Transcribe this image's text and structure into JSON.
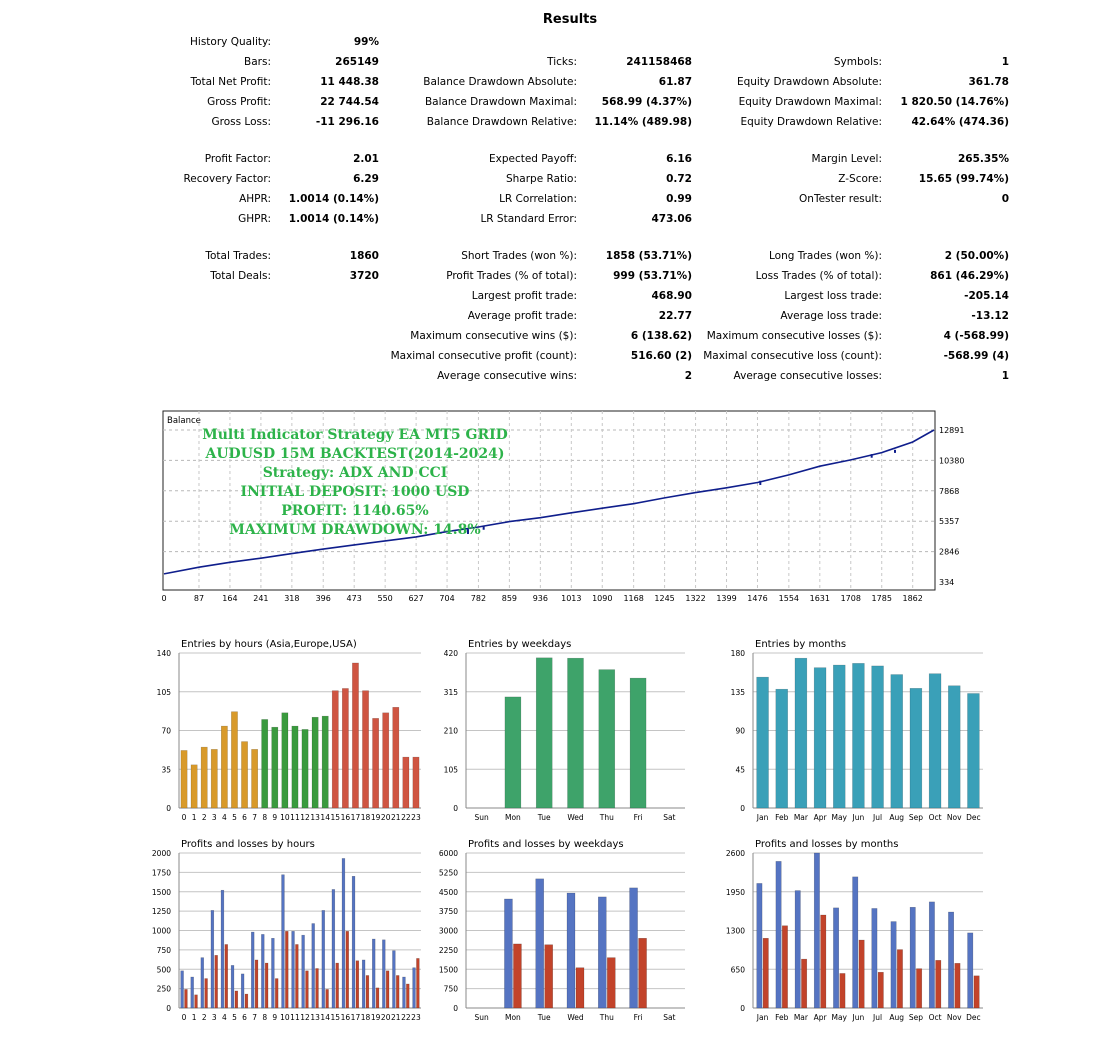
{
  "report": {
    "title": "Results",
    "col1": [
      {
        "y": 43,
        "label": "History Quality:",
        "value": "99%"
      },
      {
        "y": 63,
        "label": "Bars:",
        "value": "265149"
      },
      {
        "y": 83,
        "label": "Total Net Profit:",
        "value": "11 448.38"
      },
      {
        "y": 103,
        "label": "Gross Profit:",
        "value": "22 744.54"
      },
      {
        "y": 123,
        "label": "Gross Loss:",
        "value": "-11 296.16"
      },
      {
        "y": 160,
        "label": "Profit Factor:",
        "value": "2.01"
      },
      {
        "y": 180,
        "label": "Recovery Factor:",
        "value": "6.29"
      },
      {
        "y": 200,
        "label": "AHPR:",
        "value": "1.0014 (0.14%)"
      },
      {
        "y": 220,
        "label": "GHPR:",
        "value": "1.0014 (0.14%)"
      },
      {
        "y": 257,
        "label": "Total Trades:",
        "value": "1860"
      },
      {
        "y": 277,
        "label": "Total Deals:",
        "value": "3720"
      }
    ],
    "col2": [
      {
        "y": 63,
        "label": "Ticks:",
        "value": "241158468"
      },
      {
        "y": 83,
        "label": "Balance Drawdown Absolute:",
        "value": "61.87"
      },
      {
        "y": 103,
        "label": "Balance Drawdown Maximal:",
        "value": "568.99 (4.37%)"
      },
      {
        "y": 123,
        "label": "Balance Drawdown Relative:",
        "value": "11.14% (489.98)"
      },
      {
        "y": 160,
        "label": "Expected Payoff:",
        "value": "6.16"
      },
      {
        "y": 180,
        "label": "Sharpe Ratio:",
        "value": "0.72"
      },
      {
        "y": 200,
        "label": "LR Correlation:",
        "value": "0.99"
      },
      {
        "y": 220,
        "label": "LR Standard Error:",
        "value": "473.06"
      },
      {
        "y": 257,
        "label": "Short Trades (won %):",
        "value": "1858 (53.71%)"
      },
      {
        "y": 277,
        "label": "Profit Trades (% of total):",
        "value": "999 (53.71%)"
      },
      {
        "y": 297,
        "label": "Largest profit trade:",
        "value": "468.90"
      },
      {
        "y": 317,
        "label": "Average profit trade:",
        "value": "22.77"
      },
      {
        "y": 337,
        "label": "Maximum consecutive wins ($):",
        "value": "6 (138.62)"
      },
      {
        "y": 357,
        "label": "Maximal consecutive profit (count):",
        "value": "516.60 (2)"
      },
      {
        "y": 377,
        "label": "Average consecutive wins:",
        "value": "2"
      }
    ],
    "col3": [
      {
        "y": 63,
        "label": "Symbols:",
        "value": "1"
      },
      {
        "y": 83,
        "label": "Equity Drawdown Absolute:",
        "value": "361.78"
      },
      {
        "y": 103,
        "label": "Equity Drawdown Maximal:",
        "value": "1 820.50 (14.76%)"
      },
      {
        "y": 123,
        "label": "Equity Drawdown Relative:",
        "value": "42.64% (474.36)"
      },
      {
        "y": 160,
        "label": "Margin Level:",
        "value": "265.35%"
      },
      {
        "y": 180,
        "label": "Z-Score:",
        "value": "15.65 (99.74%)"
      },
      {
        "y": 200,
        "label": "OnTester result:",
        "value": "0"
      },
      {
        "y": 257,
        "label": "Long Trades (won %):",
        "value": "2 (50.00%)"
      },
      {
        "y": 277,
        "label": "Loss Trades (% of total):",
        "value": "861 (46.29%)"
      },
      {
        "y": 297,
        "label": "Largest loss trade:",
        "value": "-205.14"
      },
      {
        "y": 317,
        "label": "Average loss trade:",
        "value": "-13.12"
      },
      {
        "y": 337,
        "label": "Maximum consecutive losses ($):",
        "value": "4 (-568.99)"
      },
      {
        "y": 357,
        "label": "Maximal consecutive loss (count):",
        "value": "-568.99 (4)"
      },
      {
        "y": 377,
        "label": "Average consecutive losses:",
        "value": "1"
      }
    ]
  },
  "overlay": {
    "lines": [
      "Multi Indicator Strategy EA MT5 GRID",
      "AUDUSD 15M BACKTEST(2014-2024)",
      "Strategy: ADX AND CCI",
      "INITIAL DEPOSIT: 1000 USD",
      "PROFIT: 1140.65%",
      "MAXIMUM DRAWDOWN: 14.8%"
    ],
    "color": "#2db34a"
  },
  "colors": {
    "balance": "#0f1e8c",
    "hours_asia": "#d89a2a",
    "hours_europe": "#3a9a3e",
    "hours_usa": "#cf5542",
    "weekdays": "#3ea36a",
    "months": "#3aa0b8",
    "profit": "#5574c2",
    "loss": "#c2432a"
  },
  "chart_data": [
    {
      "id": "balance",
      "type": "line",
      "title": "Balance",
      "xticks": [
        "0",
        "87",
        "164",
        "241",
        "318",
        "396",
        "473",
        "550",
        "627",
        "704",
        "782",
        "859",
        "936",
        "1013",
        "1090",
        "1168",
        "1245",
        "1322",
        "1399",
        "1476",
        "1554",
        "1631",
        "1708",
        "1785",
        "1862"
      ],
      "yticks": [
        "12891",
        "10380",
        "7868",
        "5357",
        "2846",
        "334"
      ],
      "ylim": [
        334,
        12891
      ],
      "x": [
        0,
        87,
        164,
        241,
        318,
        396,
        473,
        550,
        627,
        704,
        782,
        859,
        936,
        1013,
        1090,
        1168,
        1245,
        1322,
        1399,
        1476,
        1554,
        1631,
        1708,
        1785,
        1862,
        1915
      ],
      "y": [
        1000,
        1560,
        1960,
        2300,
        2680,
        3050,
        3400,
        3730,
        4060,
        4500,
        4880,
        5320,
        5650,
        6050,
        6430,
        6800,
        7280,
        7720,
        8120,
        8550,
        9180,
        9900,
        10420,
        11020,
        11900,
        12891
      ]
    },
    {
      "id": "entries_hours",
      "type": "bar",
      "title": "Entries by hours (Asia,Europe,USA)",
      "categories": [
        "0",
        "1",
        "2",
        "3",
        "4",
        "5",
        "6",
        "7",
        "8",
        "9",
        "10",
        "11",
        "12",
        "13",
        "14",
        "15",
        "16",
        "17",
        "18",
        "19",
        "20",
        "21",
        "22",
        "23"
      ],
      "values": [
        52,
        39,
        55,
        53,
        74,
        87,
        60,
        53,
        80,
        73,
        86,
        74,
        71,
        82,
        83,
        106,
        108,
        131,
        106,
        81,
        86,
        91,
        46,
        46
      ],
      "ylim": [
        0,
        140
      ],
      "yticks": [
        "0",
        "35",
        "70",
        "105",
        "140"
      ]
    },
    {
      "id": "entries_weekdays",
      "type": "bar",
      "title": "Entries by weekdays",
      "categories": [
        "Sun",
        "Mon",
        "Tue",
        "Wed",
        "Thu",
        "Fri",
        "Sat"
      ],
      "values": [
        0,
        301,
        407,
        406,
        375,
        352,
        0
      ],
      "ylim": [
        0,
        420
      ],
      "yticks": [
        "0",
        "105",
        "210",
        "315",
        "420"
      ]
    },
    {
      "id": "entries_months",
      "type": "bar",
      "title": "Entries by months",
      "categories": [
        "Jan",
        "Feb",
        "Mar",
        "Apr",
        "May",
        "Jun",
        "Jul",
        "Aug",
        "Sep",
        "Oct",
        "Nov",
        "Dec"
      ],
      "values": [
        152,
        138,
        174,
        163,
        166,
        168,
        165,
        155,
        139,
        156,
        142,
        133
      ],
      "ylim": [
        0,
        180
      ],
      "yticks": [
        "0",
        "45",
        "90",
        "135",
        "180"
      ]
    },
    {
      "id": "pl_hours",
      "type": "bar",
      "title": "Profits and losses by hours",
      "categories": [
        "0",
        "1",
        "2",
        "3",
        "4",
        "5",
        "6",
        "7",
        "8",
        "9",
        "10",
        "11",
        "12",
        "13",
        "14",
        "15",
        "16",
        "17",
        "18",
        "19",
        "20",
        "21",
        "22",
        "23"
      ],
      "series": [
        {
          "values": [
            480,
            400,
            650,
            1260,
            1520,
            550,
            440,
            980,
            950,
            900,
            1720,
            990,
            940,
            1090,
            1260,
            1530,
            1930,
            1700,
            620,
            890,
            880,
            740,
            400,
            520
          ]
        },
        {
          "values": [
            240,
            170,
            380,
            680,
            820,
            220,
            180,
            620,
            580,
            380,
            990,
            820,
            480,
            510,
            240,
            580,
            990,
            610,
            420,
            260,
            480,
            420,
            310,
            640
          ]
        }
      ],
      "ylim": [
        0,
        2000
      ],
      "yticks": [
        "0",
        "250",
        "500",
        "750",
        "1000",
        "1250",
        "1500",
        "1750",
        "2000"
      ]
    },
    {
      "id": "pl_weekdays",
      "type": "bar",
      "title": "Profits and losses by weekdays",
      "categories": [
        "Sun",
        "Mon",
        "Tue",
        "Wed",
        "Thu",
        "Fri",
        "Sat"
      ],
      "series": [
        {
          "values": [
            0,
            4220,
            5000,
            4450,
            4300,
            4650,
            0
          ]
        },
        {
          "values": [
            0,
            2480,
            2450,
            1560,
            1950,
            2700,
            0
          ]
        }
      ],
      "ylim": [
        0,
        6000
      ],
      "yticks": [
        "0",
        "750",
        "1500",
        "2250",
        "3000",
        "3750",
        "4500",
        "5250",
        "6000"
      ]
    },
    {
      "id": "pl_months",
      "type": "bar",
      "title": "Profits and losses by months",
      "categories": [
        "Jan",
        "Feb",
        "Mar",
        "Apr",
        "May",
        "Jun",
        "Jul",
        "Aug",
        "Sep",
        "Oct",
        "Nov",
        "Dec"
      ],
      "series": [
        {
          "values": [
            2090,
            2460,
            1970,
            2600,
            1680,
            2200,
            1670,
            1450,
            1690,
            1780,
            1610,
            1260
          ]
        },
        {
          "values": [
            1170,
            1380,
            820,
            1560,
            580,
            1140,
            600,
            980,
            660,
            800,
            750,
            540
          ]
        }
      ],
      "ylim": [
        0,
        2600
      ],
      "yticks": [
        "0",
        "650",
        "1300",
        "1950",
        "2600"
      ]
    }
  ]
}
